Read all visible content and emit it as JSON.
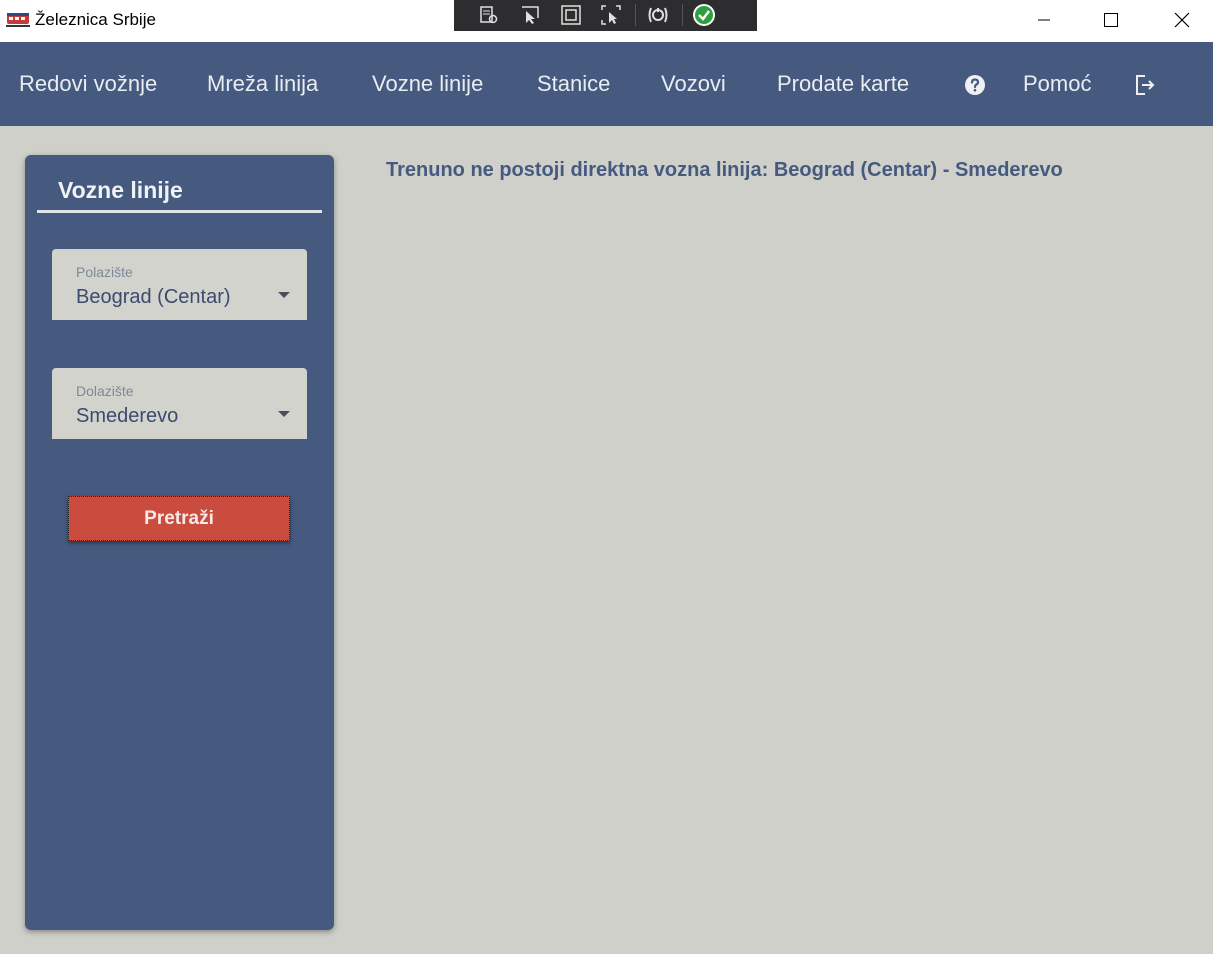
{
  "window": {
    "title": "Železnica Srbije"
  },
  "nav": {
    "items": [
      {
        "label": "Redovi vožnje"
      },
      {
        "label": "Mreža linija"
      },
      {
        "label": "Vozne linije"
      },
      {
        "label": "Stanice"
      },
      {
        "label": "Vozovi"
      },
      {
        "label": "Prodate karte"
      }
    ],
    "help_label": "Pomoć"
  },
  "panel": {
    "title": "Vozne linije",
    "departure": {
      "label": "Polazište",
      "value": "Beograd (Centar)"
    },
    "arrival": {
      "label": "Dolazište",
      "value": "Smederevo"
    },
    "search_label": "Pretraži"
  },
  "main": {
    "message": "Trenuno ne postoji direktna vozna linija: Beograd (Centar) - Smederevo"
  },
  "colors": {
    "nav_background": "#465a80",
    "page_background": "#cfd0ca",
    "search_button": "#c94c3f",
    "message_text": "#465a80"
  },
  "icons": {
    "app": "train-icon",
    "help": "question-circle-icon",
    "logout": "logout-icon",
    "debug_tools": [
      "live-visual-tree-icon",
      "select-element-icon",
      "display-layout-adorners-icon",
      "track-focused-element-icon",
      "hot-reload-icon",
      "binding-check-icon"
    ]
  }
}
